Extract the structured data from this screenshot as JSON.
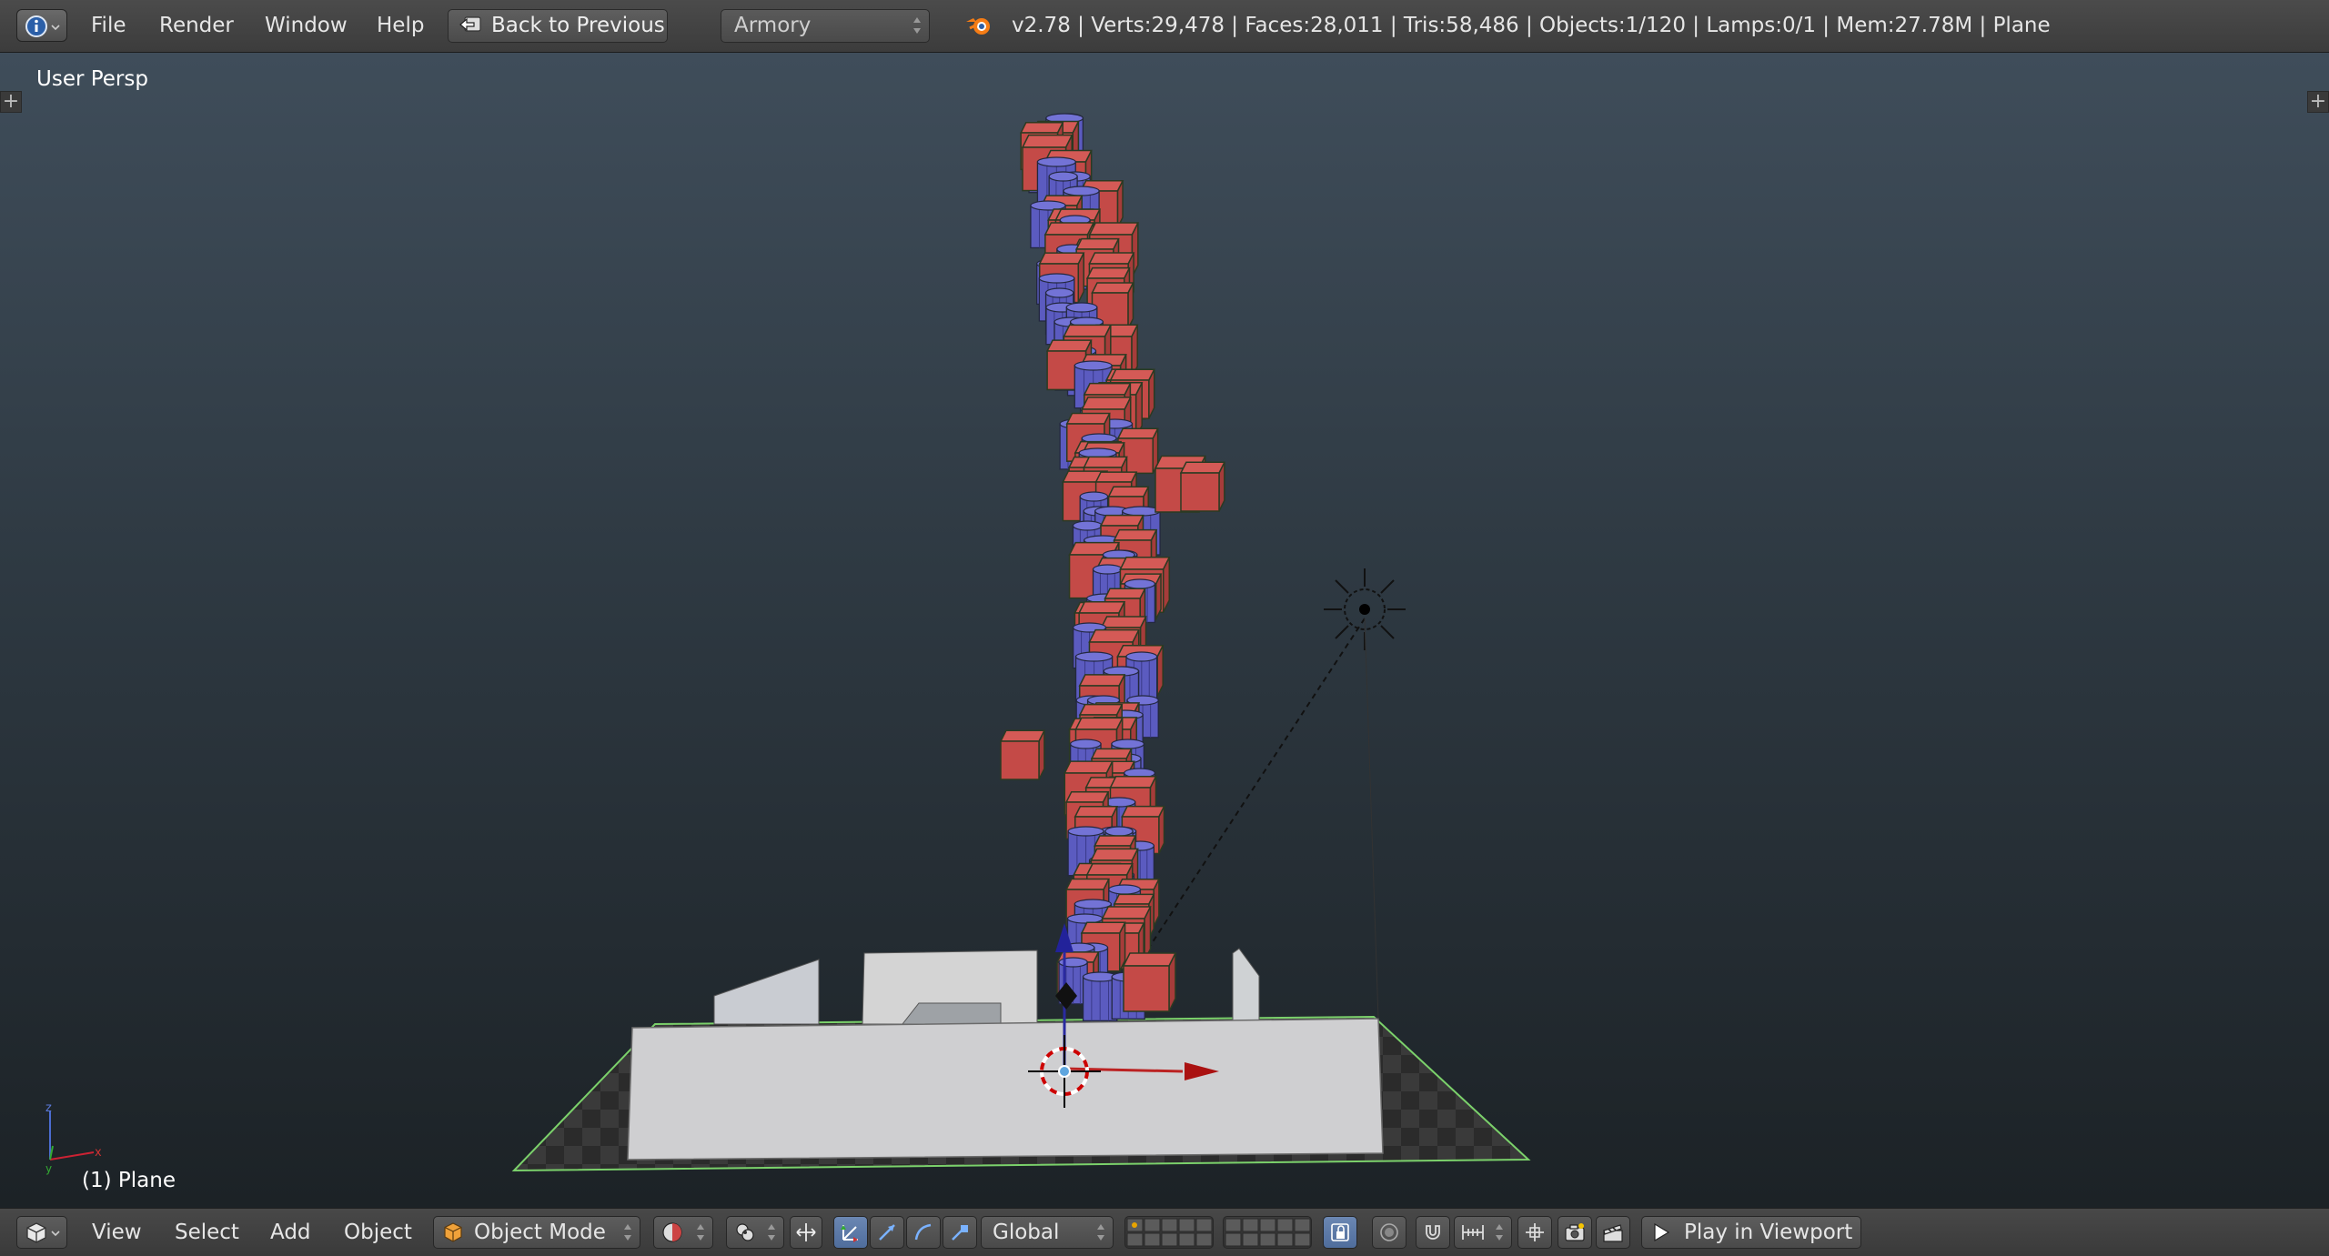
{
  "topbar": {
    "menus": [
      "File",
      "Render",
      "Window",
      "Help"
    ],
    "back_button": "Back to Previous",
    "screen_layout": "Armory",
    "stats": "v2.78 | Verts:29,478 | Faces:28,011 | Tris:58,486 | Objects:1/120 | Lamps:0/1 | Mem:27.78M | Plane"
  },
  "viewport": {
    "view_name": "User Persp",
    "active_object": "(1) Plane"
  },
  "bottombar": {
    "menus": [
      "View",
      "Select",
      "Add",
      "Object"
    ],
    "mode": "Object Mode",
    "orientation": "Global",
    "play_button": "Play in Viewport"
  },
  "colors": {
    "accent_blue": "#5680c2",
    "cube_red": "#c44a47",
    "cylinder_blue": "#5b5bc0"
  }
}
